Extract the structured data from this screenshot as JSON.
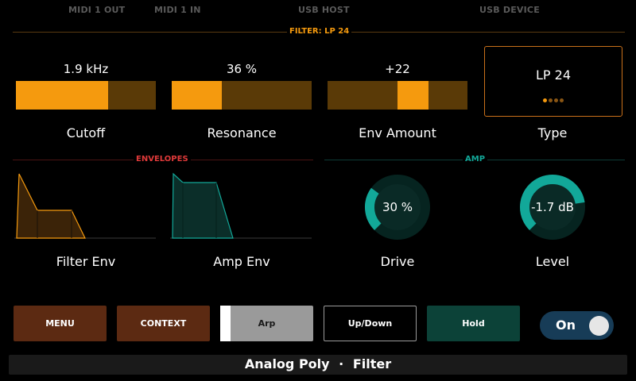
{
  "status_bar": {
    "midi_out": "MIDI 1 OUT",
    "midi_in": "MIDI 1 IN",
    "usb_host": "USB HOST",
    "usb_device": "USB DEVICE"
  },
  "filter_section": {
    "title": "FILTER: LP 24",
    "params": [
      {
        "label": "Cutoff",
        "value": "1.9 kHz",
        "level": 0.66
      },
      {
        "label": "Resonance",
        "value": "36 %",
        "level": 0.36
      },
      {
        "label": "Env Amount",
        "value": "+22",
        "range_start": 0.5,
        "range_end": 0.72
      }
    ],
    "type": {
      "label": "Type",
      "value": "LP 24",
      "selected_index": 0,
      "options_count": 4
    }
  },
  "envelopes_section": {
    "title": "ENVELOPES",
    "filter_env": {
      "label": "Filter Env"
    },
    "amp_env": {
      "label": "Amp Env"
    }
  },
  "amp_section": {
    "title": "AMP",
    "drive": {
      "label": "Drive",
      "value": "30 %",
      "level": 0.3
    },
    "level": {
      "label": "Level",
      "value": "-1.7 dB",
      "level": 0.8
    }
  },
  "buttons": {
    "menu": "MENU",
    "context": "CONTEXT",
    "arp": "Arp",
    "updown": "Up/Down",
    "hold": "Hold"
  },
  "toggle": {
    "label": "On",
    "state": true
  },
  "footer": {
    "instrument": "Analog Poly",
    "separator": "·",
    "page": "Filter"
  },
  "colors": {
    "filter_accent": "#f59a0e",
    "filter_track": "#5a3a07",
    "envelope_header": "#e03a3a",
    "amp_accent": "#12a899",
    "menu_button": "#5c2a12",
    "hold_button": "#0c4238",
    "toggle_bg": "#173c57"
  }
}
